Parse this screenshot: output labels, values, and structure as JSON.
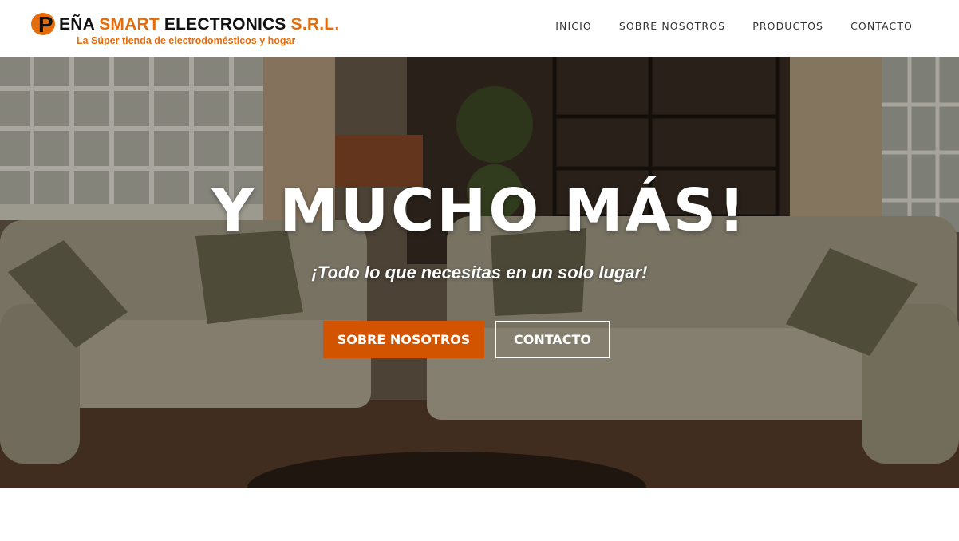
{
  "header": {
    "logo": {
      "title_initial": "P",
      "title_rest_dark": "EÑA ",
      "title_orange": "SMART",
      "title_dark_2": " ELECTRONICS ",
      "title_orange_2": "S.R.L.",
      "tagline": "La Súper tienda de electrodomésticos y hogar"
    },
    "nav": {
      "items": [
        "INICIO",
        "SOBRE NOSOTROS",
        "PRODUCTOS",
        "CONTACTO"
      ]
    }
  },
  "hero": {
    "title": "Y MUCHO MÁS!",
    "subtitle": "¡Todo lo que necesitas en un solo lugar!",
    "primary_button": "SOBRE NOSOTROS",
    "secondary_button": "CONTACTO"
  },
  "colors": {
    "accent_orange": "#d35400",
    "logo_orange": "#e46c0a",
    "nav_text": "#333333"
  }
}
